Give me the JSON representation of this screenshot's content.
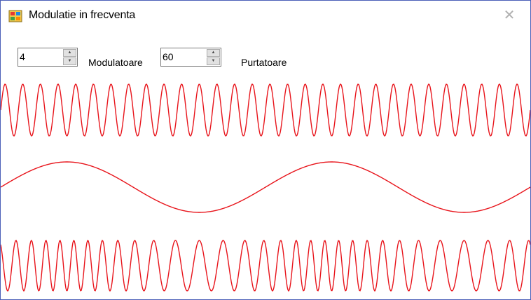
{
  "window": {
    "title": "Modulatie in frecventa",
    "icon": "app-icon",
    "close_icon": "close-icon"
  },
  "controls": {
    "modulator": {
      "value": "4",
      "label": "Modulatoare"
    },
    "carrier": {
      "value": "60",
      "label": "Purtatoare"
    }
  },
  "colors": {
    "wave": "#e8141b",
    "border": "#4a5fb8"
  },
  "chart_data": {
    "type": "line",
    "series": [
      {
        "role": "carrier",
        "cycles": 30
      },
      {
        "role": "modulator",
        "cycles": 2
      },
      {
        "role": "fm",
        "carrier_cycles": 30,
        "modulator_cycles": 2
      }
    ]
  }
}
